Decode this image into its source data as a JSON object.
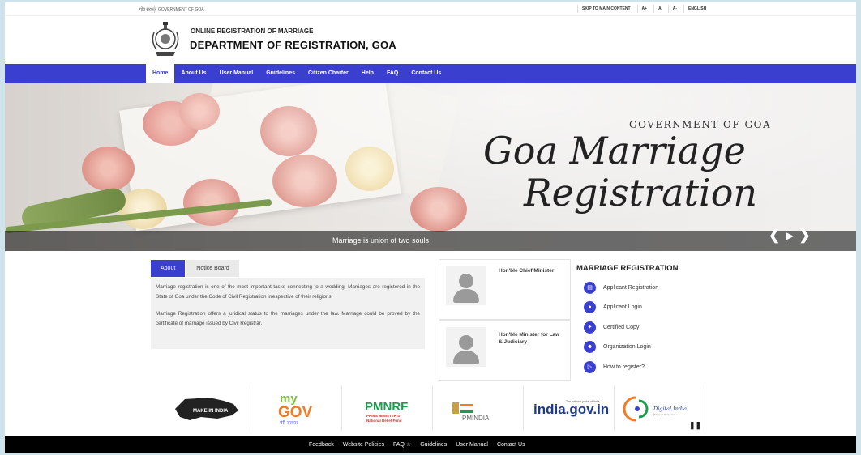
{
  "topbar": {
    "gov_hindi": "गोंय सरकार",
    "gov_en": "GOVERNMENT OF GOA",
    "skip": "SKIP TO MAIN CONTENT",
    "font_plus": "A+",
    "font_normal": "A",
    "font_minus": "A-",
    "language": "ENGLISH"
  },
  "header": {
    "subtitle": "ONLINE REGISTRATION OF MARRIAGE",
    "title": "DEPARTMENT OF REGISTRATION, GOA"
  },
  "nav": {
    "items": [
      "Home",
      "About Us",
      "User Manual",
      "Guidelines",
      "Citizen Charter",
      "Help",
      "FAQ",
      "Contact Us"
    ]
  },
  "banner": {
    "gov_text": "GOVERNMENT OF GOA",
    "title_line1": "Goa Marriage",
    "title_line2": "Registration",
    "caption": "Marriage is union of two souls"
  },
  "about": {
    "tab_about": "About",
    "tab_notice": "Notice Board",
    "para1": "Marriage registration is one of the most important tasks connecting to a wedding. Marriages are registered in the State of Goa under the Code of Civil Registration irrespective of their religions.",
    "para2": "Marriage Registration offers a juridical status to the marriages under the law. Marriage could be proved by the certificate of marriage issued by Civil Registrar."
  },
  "ministers": {
    "chief": "Hon'ble Chief Minister",
    "law": "Hon'ble Minister for Law & Judiciary"
  },
  "marriage_registration": {
    "title": "MARRIAGE REGISTRATION",
    "items": [
      {
        "label": "Applicant Registration",
        "icon": "document-icon"
      },
      {
        "label": "Applicant Login",
        "icon": "user-icon"
      },
      {
        "label": "Certified Copy",
        "icon": "certificate-icon"
      },
      {
        "label": "Organization Login",
        "icon": "group-icon"
      },
      {
        "label": "How to register?",
        "icon": "video-icon"
      }
    ]
  },
  "logos": {
    "make_in_india": "MAKE IN INDIA",
    "mygov_my": "my",
    "mygov_gov": "GOV",
    "mygov_hindi": "मेरी सरकार",
    "pmnrf": "PMNRF",
    "pmnrf_sub1": "PRIME MINISTER'S",
    "pmnrf_sub2": "National Relief Fund",
    "pmindia": "PMINDIA",
    "india_gov_small": "The national portal of India",
    "india_gov": "india.gov.in",
    "digital_india": "Digital India",
    "digital_india_sub": "Power To Empower"
  },
  "footer": {
    "links": [
      "Feedback",
      "Website Policies",
      "FAQ ☆",
      "Guidelines",
      "User Manual",
      "Contact Us"
    ]
  },
  "colors": {
    "primary": "#3b3fd0",
    "footer_bg": "#000000"
  }
}
